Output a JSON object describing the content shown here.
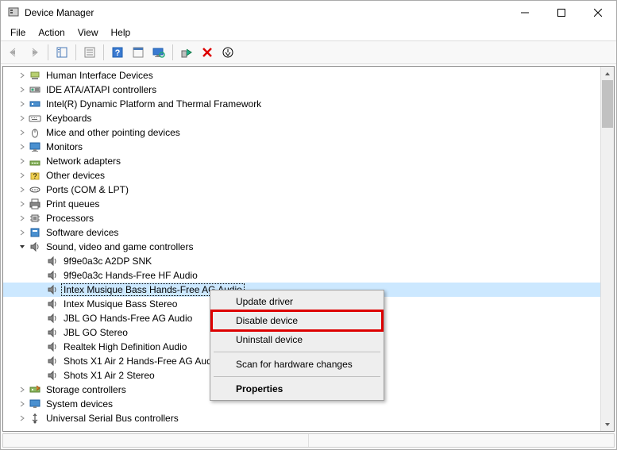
{
  "window": {
    "title": "Device Manager"
  },
  "menu": {
    "file": "File",
    "action": "Action",
    "view": "View",
    "help": "Help"
  },
  "tree": {
    "items": [
      {
        "label": "Human Interface Devices",
        "icon": "hid"
      },
      {
        "label": "IDE ATA/ATAPI controllers",
        "icon": "ide"
      },
      {
        "label": "Intel(R) Dynamic Platform and Thermal Framework",
        "icon": "intel"
      },
      {
        "label": "Keyboards",
        "icon": "keyboard"
      },
      {
        "label": "Mice and other pointing devices",
        "icon": "mouse"
      },
      {
        "label": "Monitors",
        "icon": "monitor"
      },
      {
        "label": "Network adapters",
        "icon": "network"
      },
      {
        "label": "Other devices",
        "icon": "other"
      },
      {
        "label": "Ports (COM & LPT)",
        "icon": "port"
      },
      {
        "label": "Print queues",
        "icon": "printer"
      },
      {
        "label": "Processors",
        "icon": "cpu"
      },
      {
        "label": "Software devices",
        "icon": "software"
      }
    ],
    "expanded": {
      "label": "Sound, video and game controllers",
      "children": [
        "9f9e0a3c A2DP SNK",
        "9f9e0a3c Hands-Free HF Audio",
        "Intex Musique Bass Hands-Free AG Audio",
        "Intex Musique Bass Stereo",
        "JBL GO Hands-Free AG Audio",
        "JBL GO Stereo",
        "Realtek High Definition Audio",
        "Shots X1 Air 2 Hands-Free AG Audio",
        "Shots X1 Air 2 Stereo"
      ],
      "selectedIndex": 2
    },
    "itemsAfter": [
      {
        "label": "Storage controllers",
        "icon": "storage"
      },
      {
        "label": "System devices",
        "icon": "system"
      },
      {
        "label": "Universal Serial Bus controllers",
        "icon": "usb"
      }
    ]
  },
  "contextMenu": {
    "updateDriver": "Update driver",
    "disableDevice": "Disable device",
    "uninstallDevice": "Uninstall device",
    "scanHardware": "Scan for hardware changes",
    "properties": "Properties"
  }
}
